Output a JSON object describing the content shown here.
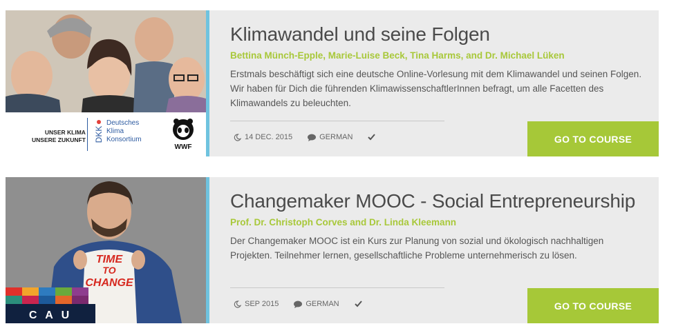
{
  "courses": [
    {
      "title": "Klimawandel und seine Folgen",
      "authors": "Bettina Münch-Epple, Marie-Luise Beck, Tina Harms, and Dr. Michael Lüken",
      "description": "Erstmals beschäftigt sich eine deutsche Online-Vorlesung mit dem Klimawandel und seinen Folgen. Wir haben für Dich die führenden KlimawissenschaftlerInnen befragt, um alle Facetten des Klimawandels zu beleuchten.",
      "date": "14 DEC. 2015",
      "language": "GERMAN",
      "button": "GO TO COURSE",
      "thumb": {
        "tagline_1": "UNSER KLIMA",
        "tagline_2": "UNSERE ZUKUNFT",
        "org_1": "Deutsches",
        "org_2": "Klima",
        "org_3": "Konsortium",
        "logo_letters": "DKK",
        "wwf": "WWF"
      }
    },
    {
      "title": "Changemaker MOOC - Social Entrepreneurship",
      "authors": "Prof. Dr. Christoph Corves and Dr. Linda Kleemann",
      "description": "Der Changemaker MOOC ist ein Kurs zur Planung von sozial und ökologisch nachhaltigen Projekten. Teilnehmer lernen, gesellschaftliche Probleme unternehmerisch zu lösen.",
      "date": "SEP 2015",
      "language": "GERMAN",
      "button": "GO TO COURSE",
      "thumb": {
        "shirt_1": "TIME",
        "shirt_2": "TO",
        "shirt_3": "CHANGE",
        "logo": "C A U"
      }
    }
  ],
  "colors": {
    "accent_bar": "#6fc3df",
    "authors": "#a8c83a",
    "button": "#a6c838",
    "card": "#ebebeb"
  },
  "icons": [
    "moon-icon",
    "speech-bubble-icon",
    "checkmark-icon"
  ]
}
